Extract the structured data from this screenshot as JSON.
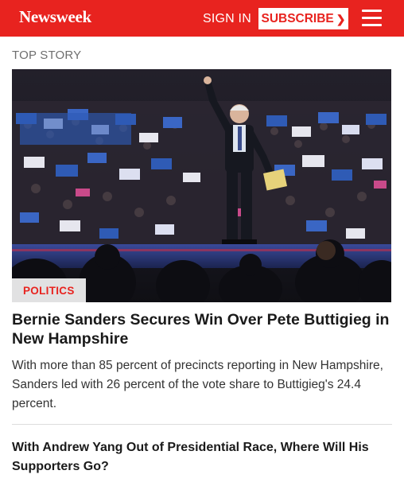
{
  "header": {
    "logo": "Newsweek",
    "sign_in": "SIGN IN",
    "subscribe": "SUBSCRIBE",
    "subscribe_icon": "chevron-right-icon",
    "menu_icon": "hamburger-menu-icon",
    "brand_color": "#e8231f"
  },
  "top_story": {
    "section_label": "TOP STORY",
    "category": "POLITICS",
    "headline": "Bernie Sanders Secures Win Over Pete Buttigieg in New Hampshire",
    "summary": "With more than 85 percent of precincts reporting in New Hampshire, Sanders led with 26 percent of the vote share to Buttigieg's 24.4 percent."
  },
  "next_story": {
    "headline": "With Andrew Yang Out of Presidential Race, Where Will His Supporters Go?"
  }
}
